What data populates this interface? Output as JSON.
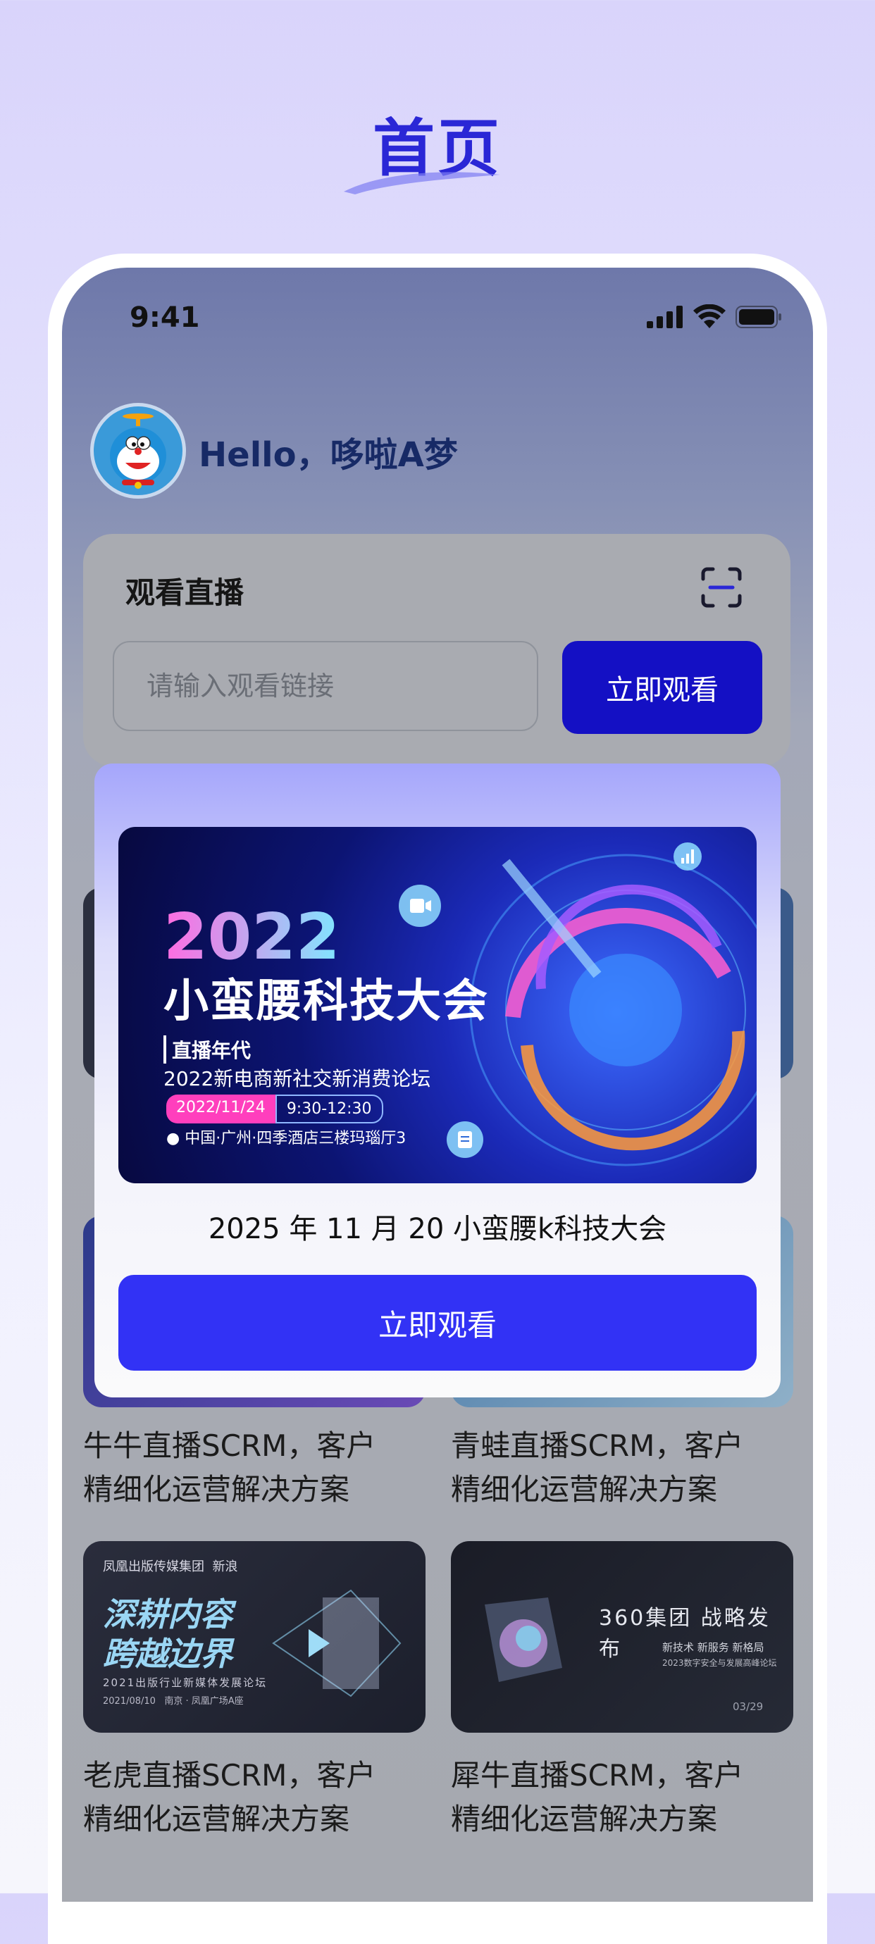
{
  "page": {
    "heading": "首页"
  },
  "status_bar": {
    "time": "9:41"
  },
  "header": {
    "greeting": "Hello，哆啦A梦"
  },
  "watch_live": {
    "title": "观看直播",
    "input_placeholder": "请输入观看链接",
    "button_label": "立即观看"
  },
  "grid": {
    "items": [
      {
        "caption_line1": "牛牛直播SCRM，客户",
        "caption_line2": "精细化运营解决方案"
      },
      {
        "caption_line1": "青蛙直播SCRM，客户",
        "caption_line2": "精细化运营解决方案"
      },
      {
        "caption_line1": "老虎直播SCRM，客户",
        "caption_line2": "精细化运营解决方案",
        "thumb_brand": "凤凰出版传媒集团",
        "thumb_brand2": "新浪",
        "thumb_text1": "深耕内容",
        "thumb_text2": "跨越边界",
        "thumb_subtitle": "2021出版行业新媒体发展论坛",
        "thumb_date": "2021/08/10",
        "thumb_place": "南京 · 凤凰广场A座"
      },
      {
        "caption_line1": "犀牛直播SCRM，客户",
        "caption_line2": "精细化运营解决方案",
        "thumb_title": "360集团 战略发布",
        "thumb_sub": "新技术  新服务  新格局",
        "thumb_sub2": "2023数字安全与发展高峰论坛",
        "thumb_date": "03/29"
      }
    ]
  },
  "modal": {
    "banner": {
      "year": "2022",
      "title": "小蛮腰科技大会",
      "tagline": "直播年代",
      "forum": "2022新电商新社交新消费论坛",
      "date": "2022/11/24",
      "time": "9:30-12:30",
      "venue": "中国·广州·四季酒店三楼玛瑙厅3"
    },
    "event_title": "2025 年 11 月 20 小蛮腰k科技大会",
    "button_label": "立即观看"
  },
  "colors": {
    "accent": "#2a27d6",
    "button": "#1410c4",
    "modal_button": "#3232f5"
  },
  "icons": [
    "signal-icon",
    "wifi-icon",
    "battery-icon",
    "scan-icon",
    "video-icon",
    "chart-icon",
    "document-icon",
    "location-icon",
    "play-icon"
  ]
}
